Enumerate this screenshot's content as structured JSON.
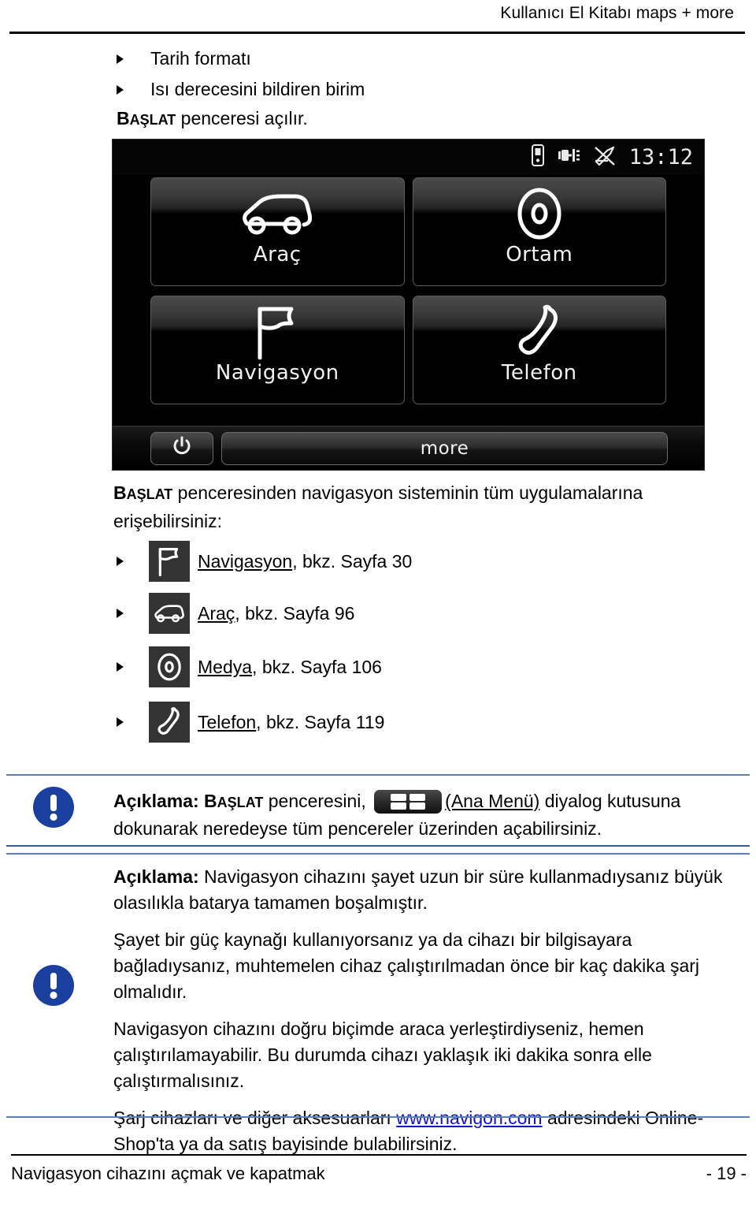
{
  "header": {
    "title": "Kullanıcı El Kitabı maps + more"
  },
  "top_bullets": [
    {
      "label": "Tarih formatı"
    },
    {
      "label": "Isı derecesini bildiren birim"
    }
  ],
  "start_window_line": {
    "caps_big": "B",
    "caps_small": "AŞLAT",
    "rest": " penceresi açılır."
  },
  "device": {
    "statusbar": {
      "icons": [
        "battery-icon",
        "plug-icon",
        "gps-off-icon"
      ],
      "clock": "13:12"
    },
    "tiles": [
      {
        "icon": "car-icon",
        "label": "Araç"
      },
      {
        "icon": "disc-icon",
        "label": "Ortam"
      },
      {
        "icon": "flag-icon",
        "label": "Navigasyon"
      },
      {
        "icon": "phone-icon",
        "label": "Telefon"
      }
    ],
    "bottom": {
      "power_icon": "power-icon",
      "more_label": "more"
    }
  },
  "intro": {
    "caps_big": "B",
    "caps_small": "AŞLAT",
    "rest": " penceresinden navigasyon sisteminin tüm uygulamalarına erişebilirsiniz:"
  },
  "app_list": [
    {
      "icon": "flag-icon",
      "link": "Navigasyon",
      "ref": ", bkz. Sayfa 30"
    },
    {
      "icon": "car-icon",
      "link": "Araç",
      "ref": ", bkz. Sayfa 96"
    },
    {
      "icon": "disc-icon",
      "link": "Medya",
      "ref": ", bkz. Sayfa 106"
    },
    {
      "icon": "phone-icon",
      "link": "Telefon",
      "ref": ", bkz. Sayfa 119"
    }
  ],
  "note_one": {
    "icon": "info-exclamation-icon",
    "label": "Açıklama:",
    "caps_big": " B",
    "caps_small": "AŞLAT",
    "part1": " penceresini, ",
    "menu_chip": "main-menu-icon",
    "link": "(Ana Menü)",
    "part2": " diyalog kutusuna dokunarak neredeyse tüm pencereler üzerinden açabilirsiniz."
  },
  "note_two": {
    "icon": "info-exclamation-icon",
    "label": "Açıklama:",
    "paragraphs": [
      " Navigasyon cihazını şayet uzun bir süre kullanmadıysanız büyük olasılıkla batarya tamamen boşalmıştır.",
      "Şayet bir güç kaynağı kullanıyorsanız ya da cihazı bir bilgisayara bağladıysanız, muhtemelen cihaz çalıştırılmadan önce bir kaç dakika şarj olmalıdır.",
      "Navigasyon cihazını doğru biçimde araca yerleştirdiyseniz, hemen çalıştırılamayabilir. Bu durumda cihazı yaklaşık iki dakika sonra elle çalıştırmalısınız."
    ],
    "last_paragraph": {
      "pre": "Şarj cihazları ve diğer aksesuarları ",
      "link": "www.navigon.com",
      "post": " adresindeki Online-Shop'ta ya da satış bayisinde bulabilirsiniz."
    }
  },
  "footer": {
    "left": "Navigasyon cihazını açmak ve kapatmak",
    "right": "- 19 -"
  },
  "colors": {
    "accent_blue": "#1b3f9e",
    "rule_blue": "#5b7fb4",
    "link_blue": "#1111cc",
    "chip_bg": "#333333"
  }
}
